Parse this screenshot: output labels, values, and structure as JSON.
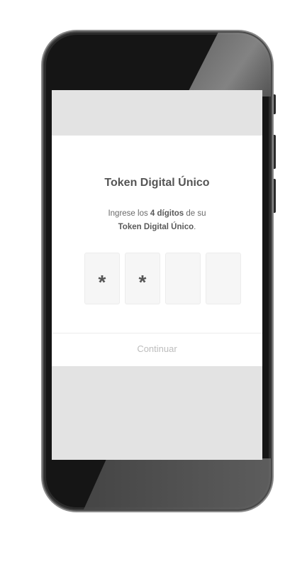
{
  "dialog": {
    "title": "Token Digital Único",
    "subtitle_prefix": "Ingrese los ",
    "subtitle_bold_1": "4 dígitos",
    "subtitle_mid": " de su",
    "subtitle_bold_2": "Token Digital Único",
    "subtitle_suffix": "."
  },
  "token_digits": [
    "*",
    "*",
    "",
    ""
  ],
  "actions": {
    "continue_label": "Continuar"
  },
  "colors": {
    "screen_background": "#e3e3e3",
    "card_background": "#ffffff",
    "phone_frame": "#151515",
    "disabled_text": "#bdbdbd"
  }
}
